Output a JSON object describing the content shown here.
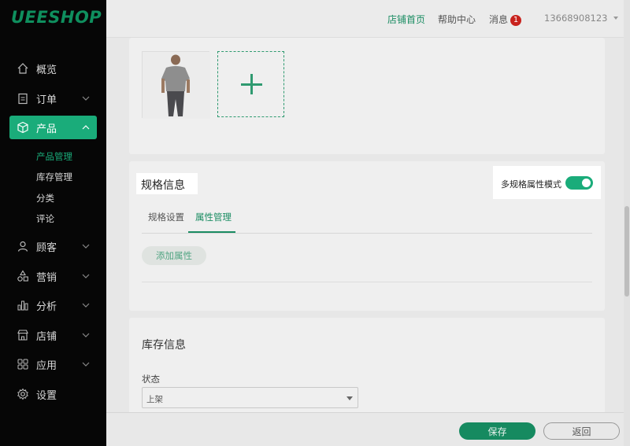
{
  "brand": {
    "logo": "UEESHOP",
    "accent": "#1aac7a"
  },
  "sidebar": {
    "items": [
      {
        "label": "概览",
        "icon": "home-icon"
      },
      {
        "label": "订单",
        "icon": "clipboard-icon"
      },
      {
        "label": "产品",
        "icon": "box-icon"
      },
      {
        "label": "顾客",
        "icon": "user-icon"
      },
      {
        "label": "营销",
        "icon": "shapes-icon"
      },
      {
        "label": "分析",
        "icon": "bar-chart-icon"
      },
      {
        "label": "店铺",
        "icon": "store-icon"
      },
      {
        "label": "应用",
        "icon": "apps-icon"
      },
      {
        "label": "设置",
        "icon": "gear-icon"
      }
    ],
    "product_sub": [
      "产品管理",
      "库存管理",
      "分类",
      "评论"
    ]
  },
  "topbar": {
    "store_home": "店铺首页",
    "help_center": "帮助中心",
    "messages": "消息",
    "message_count": "1",
    "user": "13668908123"
  },
  "spec": {
    "title": "规格信息",
    "toggle_label": "多规格属性模式",
    "toggle_on": true,
    "tabs": [
      "规格设置",
      "属性管理"
    ],
    "add_attribute": "添加属性"
  },
  "stock": {
    "title": "库存信息",
    "status_label": "状态",
    "status_value": "上架"
  },
  "footer": {
    "save": "保存",
    "back": "返回"
  }
}
